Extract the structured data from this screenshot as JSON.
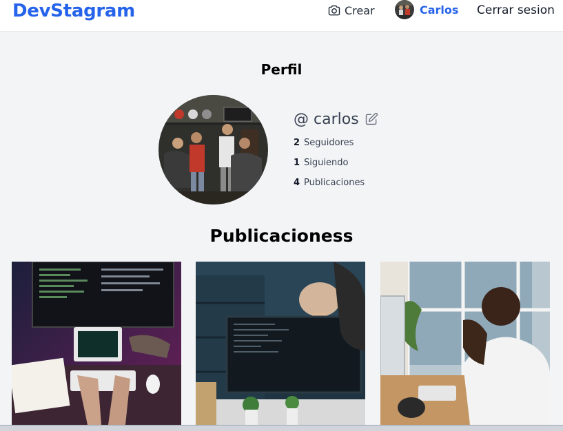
{
  "header": {
    "logo": "DevStagram",
    "create_label": "Crear",
    "user_name": "Carlos",
    "logout_label": "Cerrar sesion"
  },
  "profile": {
    "title": "Perfil",
    "username": "@ carlos",
    "followers_count": "2",
    "followers_label": "Seguidores",
    "following_count": "1",
    "following_label": "Siguiendo",
    "posts_count": "4",
    "posts_label": "Publicaciones"
  },
  "posts": {
    "title": "Publicacioness",
    "items": [
      {
        "icon": "coding-desk-photo"
      },
      {
        "icon": "developer-monitor-photo"
      },
      {
        "icon": "thinking-man-photo"
      }
    ]
  },
  "colors": {
    "brand": "#2563eb",
    "background": "#f3f4f6"
  }
}
